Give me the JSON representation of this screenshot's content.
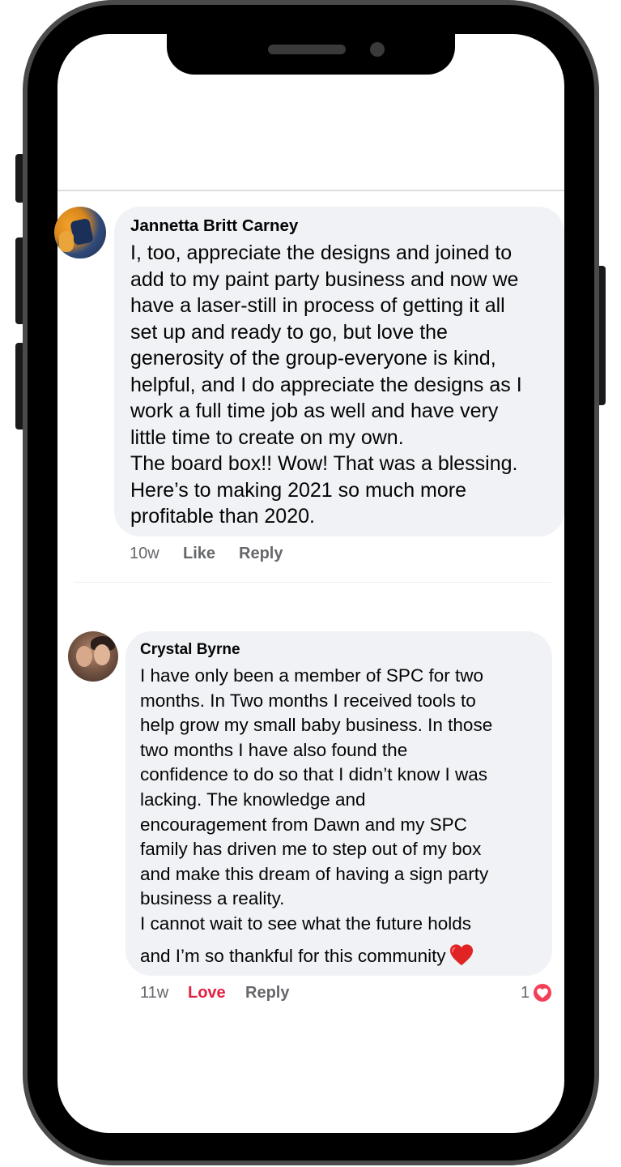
{
  "comments": [
    {
      "author": "Jannetta Britt Carney",
      "lines": [
        "I, too, appreciate the designs and joined to",
        "add to my paint party business and now we",
        "have a laser-still in process of getting it all",
        "set up and ready to go, but love the",
        "generosity of the group-everyone is kind,",
        "helpful, and I do appreciate the designs as I",
        "work a full time job as well and have very",
        "little time to create on my own.",
        "The board box!! Wow! That was a blessing.",
        "Here’s to making 2021 so much more",
        "profitable than 2020."
      ],
      "time": "10w",
      "like_label": "Like",
      "reply_label": "Reply"
    },
    {
      "author": "Crystal Byrne",
      "lines": [
        "I have only been a member of SPC for two",
        "months. In Two months I received tools to",
        "help grow my small baby business.  In those",
        "two months I have also found the",
        "confidence to do so that I didn’t know I was",
        "lacking.  The knowledge and",
        "encouragement from Dawn and my SPC",
        "family has driven me to step out of my box",
        "and make this dream of having a sign party",
        "business a reality.",
        "I cannot wait to see what the future holds",
        "and I’m so thankful for this community"
      ],
      "end_emoji": "red-heart-emoji",
      "time": "11w",
      "love_label": "Love",
      "reply_label": "Reply",
      "reaction_count": "1",
      "reaction_icon": "love-reaction-icon"
    }
  ],
  "colors": {
    "bubble": "#f0f2f5",
    "text": "#050505",
    "meta": "#65676b",
    "love": "#e41e3f"
  }
}
